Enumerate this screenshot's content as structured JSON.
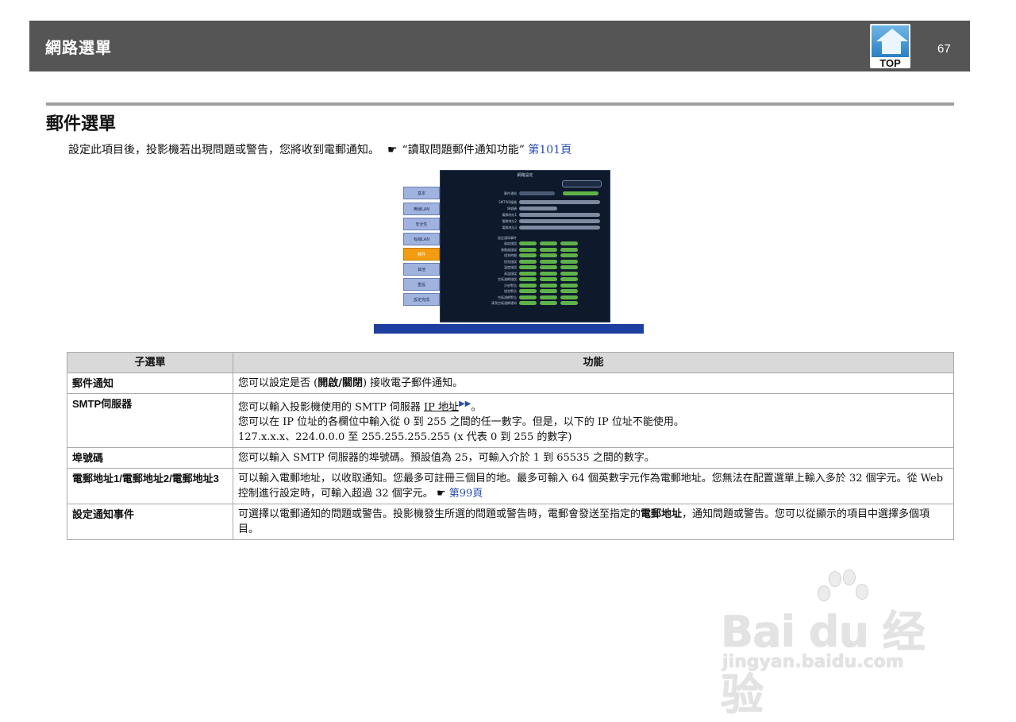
{
  "header": {
    "title": "網路選單",
    "page_number": "67",
    "top_label": "TOP"
  },
  "section": {
    "title": "郵件選單",
    "intro_text": "設定此項目後，投影機若出現問題或警告，您將收到電郵通知。",
    "intro_ref": "“讀取問題郵件通知功能”",
    "intro_link": "第101頁"
  },
  "table": {
    "headers": [
      "子選單",
      "功能"
    ],
    "rows": [
      {
        "sub": "郵件通知",
        "pre": "您可以設定是否 (",
        "bold": "開啟/關閉",
        "post": ") 接收電子郵件通知。"
      },
      {
        "sub": "SMTP伺服器",
        "line1_pre": "您可以輸入投影機使用的 SMTP 伺服器 ",
        "line1_link": "IP 地址",
        "line1_post": "。",
        "line2": "您可以在 IP 位址的各欄位中輸入從 0 到 255 之間的任一數字。但是，以下的 IP 位址不能使用。",
        "line3": "127.x.x.x、224.0.0.0 至 255.255.255.255 (x 代表 0 到 255 的數字)"
      },
      {
        "sub": "埠號碼",
        "text": "您可以輸入 SMTP 伺服器的埠號碼。預設值為 25，可輸入介於 1 到 65535 之間的數字。"
      },
      {
        "sub": "電郵地址1/電郵地址2/電郵地址3",
        "text": "可以輸入電郵地址，以收取通知。您最多可註冊三個目的地。最多可輸入 64 個英數字元作為電郵地址。您無法在配置選單上輸入多於 32 個字元。從 Web 控制進行設定時，可輸入超過 32 個字元。",
        "link": "第99頁"
      },
      {
        "sub": "設定通知事件",
        "pre": "可選擇以電郵通知的問題或警告。投影機發生所選的問題或警告時，電郵會發送至指定的",
        "bold": "電郵地址",
        "post": "，通知問題或警告。您可以從顯示的項目中選擇多個項目。"
      }
    ]
  },
  "screenshot": {
    "title": "網路設定",
    "sidebar": [
      "基本",
      "無線LAN",
      "安全性",
      "有線LAN",
      "郵件",
      "其他",
      "重設",
      "設定完成"
    ],
    "active_index": 4,
    "top_button": "返回",
    "fields": [
      "郵件通知",
      "SMTP伺服器",
      "埠號碼",
      "電郵地址1",
      "電郵地址2",
      "電郵地址3"
    ],
    "smtp_value": "000.000.000.000",
    "port_value": "00025",
    "toggle_off": "關閉",
    "toggle_on": "開啟",
    "events_title": "設定通知事件",
    "events": [
      "內部錯誤",
      "風扇錯誤",
      "感應器錯誤",
      "燈泡時間",
      "燈泡錯誤",
      "溫度錯誤",
      "高溫錯誤",
      "空氣濾網錯誤",
      "冷卻警告",
      "燈泡警告",
      "空氣濾網警告",
      "清潔空氣濾網通知"
    ],
    "bottom_left": "選擇",
    "bottom_enter": "Enter",
    "bottom_right": "確定"
  },
  "watermark": {
    "brand": "Bai du 经验",
    "url": "jingyan.baidu.com"
  },
  "colors": {
    "header_bg": "#555555",
    "rule": "#9e9e9e",
    "link": "#2a4fb0",
    "table_header_bg": "#d9d9d9",
    "active_tab": "#f39c12"
  }
}
